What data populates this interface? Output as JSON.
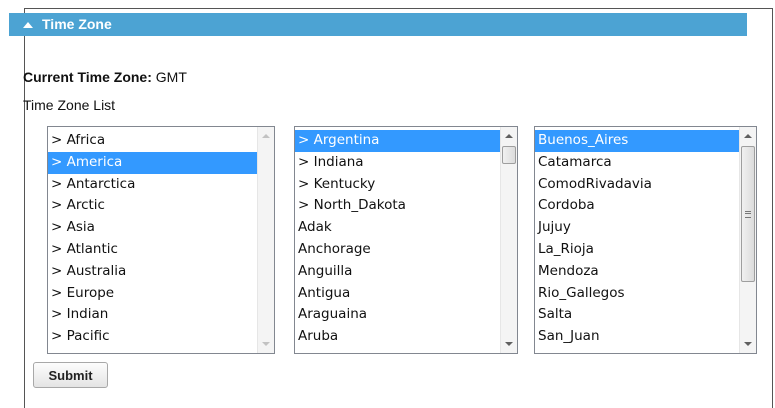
{
  "section": {
    "title": "Time Zone",
    "current_label": "Current Time Zone:",
    "current_value": "GMT",
    "list_label": "Time Zone List"
  },
  "regions": {
    "items": [
      "> Africa",
      "> America",
      "> Antarctica",
      "> Arctic",
      "> Asia",
      "> Atlantic",
      "> Australia",
      "> Europe",
      "> Indian",
      "> Pacific"
    ],
    "selected": "> America"
  },
  "america": {
    "items": [
      "> Argentina",
      "> Indiana",
      "> Kentucky",
      "> North_Dakota",
      "Adak",
      "Anchorage",
      "Anguilla",
      "Antigua",
      "Araguaina",
      "Aruba"
    ],
    "selected": "> Argentina"
  },
  "argentina": {
    "items": [
      "Buenos_Aires",
      "Catamarca",
      "ComodRivadavia",
      "Cordoba",
      "Jujuy",
      "La_Rioja",
      "Mendoza",
      "Rio_Gallegos",
      "Salta",
      "San_Juan"
    ],
    "selected": "Buenos_Aires"
  },
  "submit_label": "Submit",
  "colors": {
    "header_bg": "#4ca3d3",
    "selection_bg": "#3399ff"
  }
}
